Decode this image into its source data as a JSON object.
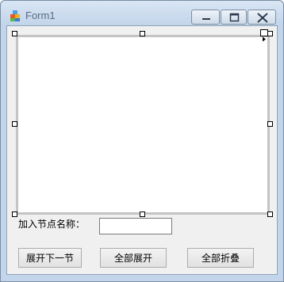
{
  "window": {
    "title": "Form1"
  },
  "caption_buttons": {
    "minimize": "minimize-icon",
    "maximize": "maximize-icon",
    "close": "close-icon"
  },
  "form": {
    "node_name_label": "加入节点名称：",
    "node_name_value": "",
    "buttons": {
      "expand_next": "展开下一节",
      "expand_all": "全部展开",
      "collapse_all": "全部折叠"
    }
  },
  "colors": {
    "title_text": "#5a6b80",
    "client_background": "#f0f0f0",
    "window_frame": "#c2d5ea"
  }
}
